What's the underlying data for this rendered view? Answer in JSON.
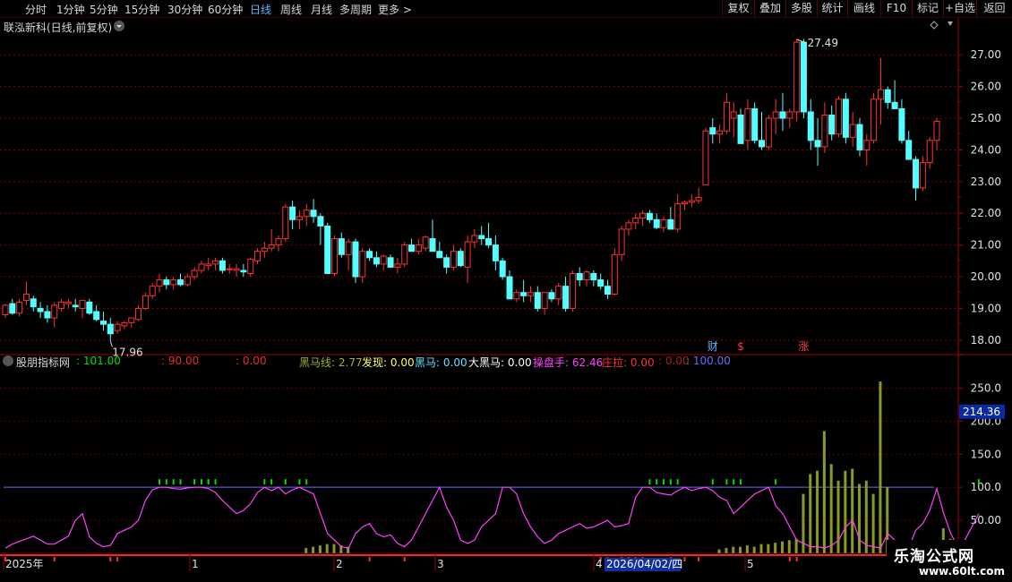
{
  "toolbar": {
    "timeframes": [
      "分时",
      "1分钟",
      "5分钟",
      "15分钟",
      "30分钟",
      "60分钟",
      "日线",
      "周线",
      "月线",
      "多周期",
      "更多 >"
    ],
    "active_index": 6,
    "right_buttons": [
      "复权",
      "叠加",
      "多股",
      "统计",
      "画线",
      "F10",
      "标记",
      "+自选",
      "返回"
    ]
  },
  "main": {
    "title": "联泓新科(日线,前复权)",
    "max_label": "27.49",
    "min_label": "17.96",
    "markers": [
      "财",
      "$",
      "涨"
    ],
    "price_axis": [
      "27.00",
      "26.00",
      "25.00",
      "24.00",
      "23.00",
      "22.00",
      "21.00",
      "20.00",
      "19.00",
      "18.00"
    ]
  },
  "indicator": {
    "name": "股朋指标网",
    "values": [
      {
        "label": "",
        "value": "101.00",
        "color": "#00e000"
      },
      {
        "label": "",
        "value": "90.00",
        "color": "#e03030"
      },
      {
        "label": "",
        "value": "0.00",
        "color": "#e03030"
      },
      {
        "label": "黑马线",
        "value": "2.77",
        "color": "#a0b040"
      },
      {
        "label": "发现",
        "value": "0.00",
        "color": "#ffff60"
      },
      {
        "label": "黑马",
        "value": "0.00",
        "color": "#60e0ff"
      },
      {
        "label": "大黑马",
        "value": "0.00",
        "color": "#ffffff"
      },
      {
        "label": "操盘手",
        "value": "62.46",
        "color": "#ff40ff"
      },
      {
        "label": "庄拉",
        "value": "0.00",
        "color": "#ff3030"
      },
      {
        "label": "",
        "value": "0.00",
        "color": "#a02020"
      },
      {
        "label": "",
        "value": "100.00",
        "color": "#6070ff"
      }
    ],
    "axis": [
      "250.0",
      "200.0",
      "150.0",
      "100.0",
      "50.00"
    ],
    "current_value": "214.36"
  },
  "date_axis": {
    "labels": [
      "2025年",
      "1",
      "2",
      "3",
      "4",
      "5"
    ],
    "highlight": "2026/04/02/四"
  },
  "watermark": {
    "line1": "乐淘公式网",
    "line2": "www.60lt.com"
  },
  "colors": {
    "up": "#ff3232",
    "down": "#54ffff",
    "line": "#ff40ff",
    "baseline": "#6070ff",
    "vol": "#8a9a20"
  },
  "chart_data": {
    "type": "candlestick",
    "ylim": [
      17.6,
      27.6
    ],
    "candles": [
      [
        18.8,
        19.15,
        18.7,
        19.1
      ],
      [
        19.15,
        19.3,
        18.8,
        18.85
      ],
      [
        18.85,
        19.3,
        18.75,
        19.2
      ],
      [
        19.25,
        19.85,
        19.1,
        19.45
      ],
      [
        19.3,
        19.4,
        18.9,
        19.05
      ],
      [
        19.0,
        19.2,
        18.7,
        18.9
      ],
      [
        18.9,
        19.1,
        18.55,
        18.7
      ],
      [
        18.7,
        19.2,
        18.4,
        19.1
      ],
      [
        19.0,
        19.3,
        18.9,
        19.2
      ],
      [
        19.15,
        19.3,
        19.0,
        19.2
      ],
      [
        19.1,
        19.3,
        18.9,
        19.05
      ],
      [
        19.0,
        19.2,
        18.7,
        19.25
      ],
      [
        19.2,
        19.3,
        18.8,
        18.85
      ],
      [
        18.9,
        19.1,
        18.6,
        18.65
      ],
      [
        18.6,
        18.9,
        18.3,
        18.5
      ],
      [
        18.5,
        18.7,
        17.96,
        18.2
      ],
      [
        18.3,
        18.6,
        18.2,
        18.5
      ],
      [
        18.45,
        18.6,
        18.35,
        18.55
      ],
      [
        18.55,
        18.7,
        18.4,
        18.7
      ],
      [
        18.65,
        19.1,
        18.6,
        19.0
      ],
      [
        19.0,
        19.5,
        18.95,
        19.4
      ],
      [
        19.4,
        19.8,
        19.3,
        19.7
      ],
      [
        19.7,
        20.1,
        19.5,
        19.9
      ],
      [
        19.9,
        20.0,
        19.6,
        19.75
      ],
      [
        19.75,
        20.0,
        19.6,
        19.9
      ],
      [
        19.9,
        20.1,
        19.7,
        19.75
      ],
      [
        19.75,
        20.1,
        19.7,
        20.0
      ],
      [
        20.0,
        20.3,
        19.9,
        20.2
      ],
      [
        20.2,
        20.5,
        20.1,
        20.4
      ],
      [
        20.35,
        20.6,
        20.2,
        20.4
      ],
      [
        20.4,
        20.6,
        20.2,
        20.5
      ],
      [
        20.5,
        20.6,
        20.1,
        20.2
      ],
      [
        20.25,
        20.4,
        20.1,
        20.25
      ],
      [
        20.2,
        20.4,
        20.0,
        20.25
      ],
      [
        20.2,
        20.4,
        20.0,
        20.15
      ],
      [
        20.1,
        20.6,
        20.0,
        20.55
      ],
      [
        20.5,
        20.9,
        20.4,
        20.8
      ],
      [
        20.8,
        21.1,
        20.6,
        20.9
      ],
      [
        20.9,
        21.5,
        20.8,
        21.0
      ],
      [
        21.0,
        21.3,
        20.8,
        21.2
      ],
      [
        21.2,
        22.3,
        21.1,
        22.2
      ],
      [
        22.2,
        22.4,
        21.5,
        21.8
      ],
      [
        21.8,
        22.1,
        21.5,
        21.9
      ],
      [
        21.9,
        22.3,
        21.6,
        22.1
      ],
      [
        22.1,
        22.45,
        21.7,
        21.9
      ],
      [
        21.9,
        22.0,
        21.0,
        21.6
      ],
      [
        21.6,
        21.7,
        20.1,
        20.1
      ],
      [
        20.1,
        21.3,
        20.0,
        21.2
      ],
      [
        21.2,
        21.4,
        20.6,
        20.7
      ],
      [
        20.7,
        21.2,
        20.2,
        21.1
      ],
      [
        21.1,
        21.2,
        19.8,
        20.0
      ],
      [
        20.0,
        20.9,
        19.8,
        20.8
      ],
      [
        20.8,
        20.9,
        20.5,
        20.6
      ],
      [
        20.6,
        20.8,
        20.3,
        20.4
      ],
      [
        20.4,
        20.7,
        20.2,
        20.65
      ],
      [
        20.6,
        20.7,
        20.3,
        20.3
      ],
      [
        20.3,
        20.6,
        20.1,
        20.4
      ],
      [
        20.4,
        21.1,
        20.3,
        21.0
      ],
      [
        21.0,
        21.2,
        20.8,
        20.8
      ],
      [
        20.8,
        21.2,
        20.7,
        21.0
      ],
      [
        20.9,
        21.3,
        20.8,
        21.25
      ],
      [
        21.2,
        21.8,
        21.0,
        20.8
      ],
      [
        20.8,
        21.1,
        20.6,
        20.6
      ],
      [
        20.6,
        20.7,
        20.1,
        20.3
      ],
      [
        20.3,
        21.0,
        20.2,
        20.8
      ],
      [
        20.8,
        20.9,
        20.3,
        20.35
      ],
      [
        20.3,
        21.3,
        19.8,
        21.1
      ],
      [
        21.1,
        21.5,
        20.9,
        21.3
      ],
      [
        21.3,
        21.6,
        21.0,
        21.2
      ],
      [
        21.2,
        21.7,
        20.9,
        21.0
      ],
      [
        21.0,
        21.3,
        20.2,
        20.5
      ],
      [
        20.5,
        20.6,
        19.9,
        20.0
      ],
      [
        20.0,
        20.2,
        19.4,
        19.3
      ],
      [
        19.3,
        19.6,
        19.2,
        19.5
      ],
      [
        19.5,
        19.9,
        19.2,
        19.4
      ],
      [
        19.4,
        19.7,
        19.2,
        19.5
      ],
      [
        19.5,
        19.7,
        18.9,
        19.0
      ],
      [
        19.0,
        19.5,
        18.8,
        19.5
      ],
      [
        19.5,
        19.6,
        19.2,
        19.3
      ],
      [
        19.3,
        19.8,
        19.1,
        19.7
      ],
      [
        19.7,
        20.0,
        18.9,
        19.0
      ],
      [
        19.0,
        20.2,
        18.9,
        20.1
      ],
      [
        20.1,
        20.3,
        19.7,
        19.9
      ],
      [
        19.9,
        20.2,
        19.7,
        20.15
      ],
      [
        20.1,
        20.2,
        19.7,
        19.9
      ],
      [
        19.9,
        20.1,
        19.6,
        19.7
      ],
      [
        19.7,
        19.9,
        19.3,
        19.45
      ],
      [
        19.45,
        20.9,
        19.4,
        20.7
      ],
      [
        20.7,
        21.6,
        20.5,
        21.5
      ],
      [
        21.5,
        21.8,
        21.3,
        21.7
      ],
      [
        21.7,
        22.0,
        21.5,
        21.85
      ],
      [
        21.85,
        22.1,
        21.6,
        22.0
      ],
      [
        22.0,
        22.1,
        21.7,
        21.8
      ],
      [
        21.8,
        22.0,
        21.5,
        21.55
      ],
      [
        21.55,
        21.9,
        21.4,
        21.8
      ],
      [
        21.8,
        22.2,
        21.5,
        21.5
      ],
      [
        21.5,
        22.6,
        21.4,
        22.3
      ],
      [
        22.3,
        22.4,
        22.1,
        22.35
      ],
      [
        22.35,
        22.6,
        22.2,
        22.4
      ],
      [
        22.4,
        22.8,
        22.3,
        22.5
      ],
      [
        22.9,
        24.7,
        22.9,
        24.6
      ],
      [
        24.7,
        25.0,
        24.2,
        24.5
      ],
      [
        24.5,
        24.8,
        24.2,
        24.6
      ],
      [
        24.6,
        25.8,
        24.5,
        25.5
      ],
      [
        25.0,
        25.5,
        24.4,
        25.2
      ],
      [
        25.1,
        25.3,
        24.2,
        24.2
      ],
      [
        24.3,
        25.6,
        24.0,
        25.3
      ],
      [
        25.3,
        25.5,
        24.2,
        24.3
      ],
      [
        24.3,
        25.2,
        24.0,
        24.1
      ],
      [
        24.1,
        25.1,
        24.0,
        25.0
      ],
      [
        25.0,
        25.6,
        24.5,
        25.2
      ],
      [
        25.2,
        25.8,
        24.6,
        25.0
      ],
      [
        25.0,
        25.3,
        24.7,
        25.2
      ],
      [
        25.2,
        27.49,
        24.9,
        27.4
      ],
      [
        27.4,
        27.5,
        25.0,
        25.2
      ],
      [
        25.2,
        25.6,
        24.0,
        24.3
      ],
      [
        24.3,
        25.0,
        23.5,
        24.1
      ],
      [
        24.1,
        25.5,
        23.9,
        25.1
      ],
      [
        25.1,
        25.4,
        24.3,
        24.5
      ],
      [
        24.5,
        25.7,
        24.4,
        25.6
      ],
      [
        25.6,
        25.8,
        24.2,
        24.4
      ],
      [
        24.4,
        25.2,
        24.1,
        24.8
      ],
      [
        24.8,
        25.0,
        23.8,
        24.0
      ],
      [
        24.0,
        24.5,
        23.5,
        24.3
      ],
      [
        24.3,
        25.8,
        24.2,
        25.6
      ],
      [
        25.6,
        26.9,
        24.8,
        25.9
      ],
      [
        25.9,
        26.0,
        25.3,
        25.5
      ],
      [
        25.5,
        26.2,
        25.3,
        25.3
      ],
      [
        25.3,
        25.6,
        24.2,
        24.3
      ],
      [
        24.3,
        24.6,
        23.7,
        23.7
      ],
      [
        23.7,
        23.8,
        22.4,
        22.8
      ],
      [
        22.8,
        23.8,
        22.7,
        23.6
      ],
      [
        23.6,
        24.4,
        23.4,
        24.3
      ],
      [
        24.3,
        25.0,
        24.0,
        24.9
      ]
    ],
    "oscillator": [
      8,
      14,
      18,
      22,
      26,
      20,
      14,
      14,
      20,
      26,
      50,
      60,
      25,
      15,
      10,
      12,
      30,
      35,
      40,
      50,
      80,
      96,
      100,
      100,
      98,
      97,
      99,
      100,
      100,
      98,
      92,
      80,
      70,
      60,
      65,
      75,
      92,
      100,
      95,
      100,
      90,
      96,
      100,
      95,
      90,
      60,
      30,
      20,
      10,
      8,
      30,
      40,
      45,
      30,
      25,
      28,
      15,
      10,
      20,
      40,
      60,
      80,
      100,
      70,
      50,
      20,
      15,
      20,
      40,
      50,
      60,
      100,
      100,
      90,
      60,
      40,
      25,
      15,
      20,
      30,
      35,
      40,
      45,
      38,
      40,
      45,
      50,
      40,
      42,
      45,
      85,
      100,
      100,
      92,
      90,
      88,
      95,
      100,
      95,
      98,
      100,
      95,
      85,
      80,
      60,
      70,
      80,
      90,
      95,
      100,
      72,
      60,
      40,
      20,
      15,
      10,
      10,
      8,
      12,
      20,
      40,
      50,
      20,
      12,
      10,
      8,
      30,
      20,
      10,
      8,
      35,
      45,
      65,
      98,
      60,
      30,
      10,
      20,
      40,
      60
    ],
    "volume": [
      0,
      0,
      0,
      0,
      0,
      0,
      0,
      0,
      0,
      0,
      0,
      0,
      0,
      0,
      0,
      0,
      0,
      0,
      0,
      0,
      0,
      0,
      0,
      0,
      0,
      0,
      0,
      0,
      0,
      0,
      0,
      0,
      0,
      0,
      0,
      0,
      0,
      0,
      0,
      0,
      0,
      0,
      0,
      8,
      10,
      12,
      14,
      14,
      12,
      10,
      0,
      0,
      0,
      0,
      0,
      0,
      0,
      0,
      0,
      0,
      0,
      0,
      0,
      0,
      0,
      0,
      0,
      0,
      0,
      0,
      0,
      0,
      0,
      0,
      0,
      0,
      0,
      0,
      0,
      0,
      0,
      0,
      0,
      0,
      0,
      0,
      0,
      0,
      0,
      0,
      0,
      0,
      0,
      0,
      0,
      0,
      0,
      0,
      0,
      0,
      0,
      0,
      6,
      8,
      10,
      10,
      12,
      10,
      14,
      14,
      16,
      18,
      20,
      22,
      90,
      120,
      125,
      185,
      135,
      110,
      125,
      128,
      105,
      110,
      90,
      260,
      100,
      0,
      8,
      12,
      15,
      18,
      16,
      12,
      38,
      22,
      20,
      10,
      12,
      8,
      12,
      15,
      0,
      0,
      0,
      0,
      0,
      0,
      0,
      0
    ],
    "signals": [
      22,
      23,
      24,
      25,
      27,
      28,
      29,
      30,
      37,
      38,
      40,
      42,
      43,
      92,
      93,
      94,
      95,
      96,
      101,
      103,
      104,
      105,
      110,
      139
    ]
  }
}
